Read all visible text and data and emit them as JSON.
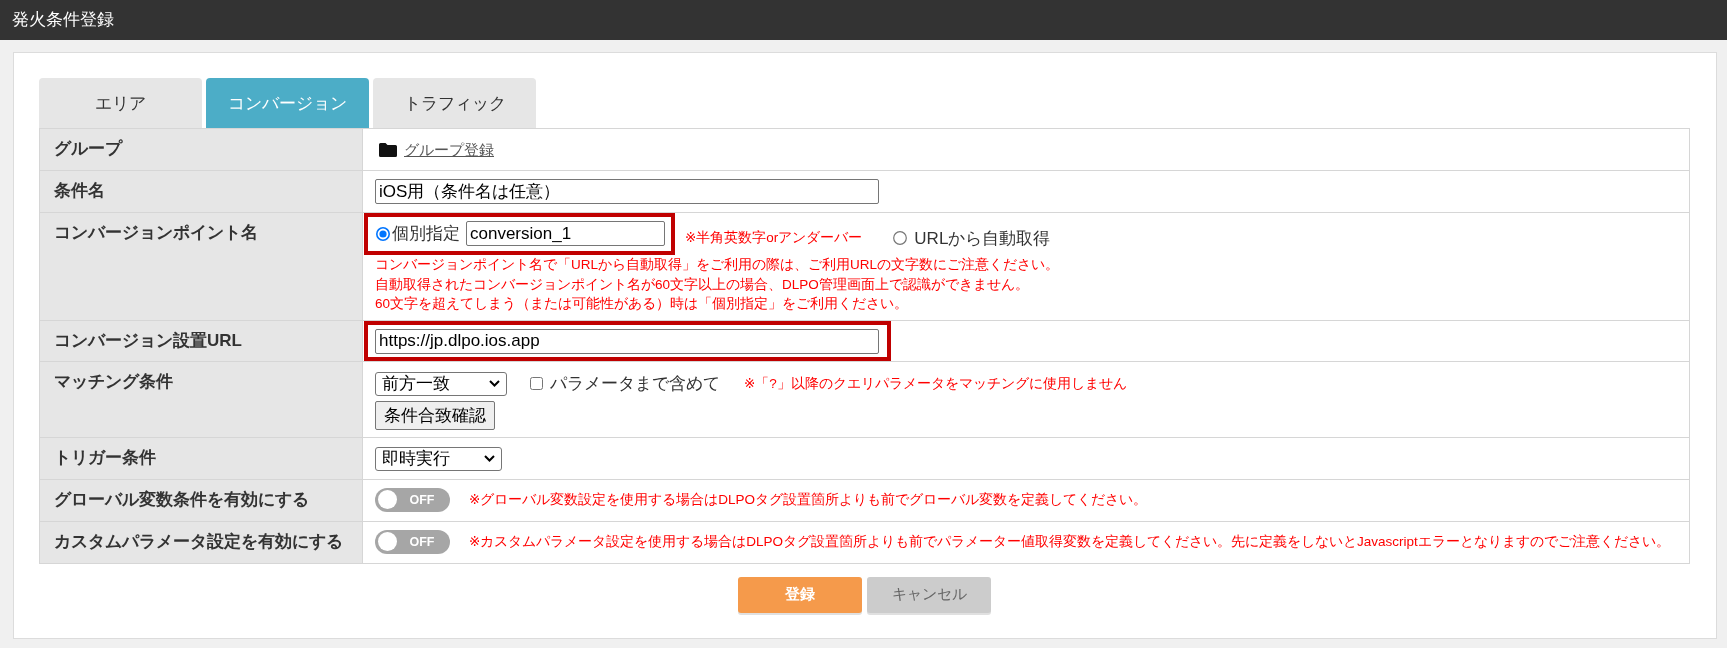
{
  "window": {
    "title": "発火条件登録"
  },
  "tabs": [
    {
      "label": "エリア",
      "selected": false
    },
    {
      "label": "コンバージョン",
      "selected": true
    },
    {
      "label": "トラフィック",
      "selected": false
    }
  ],
  "rows": [
    {
      "kind": "link",
      "label": "グループ",
      "link": "グループ登録"
    },
    {
      "kind": "text",
      "label": "条件名",
      "value": "iOS用（条件名は任意）",
      "highlighted": false
    },
    {
      "kind": "radio",
      "label": "コンバージョンポイント名",
      "options": [
        {
          "label": "個別指定",
          "selected": true,
          "value": "conversion_1",
          "highlighted": true,
          "hint": "※半角英数字orアンダーバー"
        },
        {
          "label": "URLから自動取得",
          "selected": false,
          "highlighted": false
        }
      ],
      "notes": [
        "コンバージョンポイント名で「URLから自動取得」をご利用の際は、ご利用URLの文字数にご注意ください。",
        "自動取得されたコンバージョンポイント名が60文字以上の場合、DLPO管理画面上で認識ができません。",
        "60文字を超えてしまう（または可能性がある）時は「個別指定」をご利用ください。"
      ]
    },
    {
      "kind": "text",
      "label": "コンバージョン設置URL",
      "value": "https://jp.dlpo.ios.app",
      "highlighted": true
    },
    {
      "kind": "match",
      "label": "マッチング条件",
      "select": "前方一致",
      "checkbox": {
        "label": "パラメータまで含めて",
        "checked": false
      },
      "note": "※「?」以降のクエリパラメータをマッチングに使用しません",
      "button": "条件合致確認"
    },
    {
      "kind": "select",
      "label": "トリガー条件",
      "select": "即時実行"
    },
    {
      "kind": "toggle",
      "label": "グローバル変数条件を有効にする",
      "toggle": {
        "on": false,
        "label": "OFF"
      },
      "note": "※グローバル変数設定を使用する場合はDLPOタグ設置箇所よりも前でグローバル変数を定義してください。"
    },
    {
      "kind": "toggle",
      "label": "カスタムパラメータ設定を有効にする",
      "toggle": {
        "on": false,
        "label": "OFF"
      },
      "note": "※カスタムパラメータ設定を使用する場合はDLPOタグ設置箇所よりも前でパラメーター値取得変数を定義してください。先に定義をしないとJavascriptエラーとなりますのでご注意ください。"
    }
  ],
  "buttons": [
    {
      "label": "登録",
      "kind": "primary"
    },
    {
      "label": "キャンセル",
      "kind": "secondary"
    }
  ]
}
